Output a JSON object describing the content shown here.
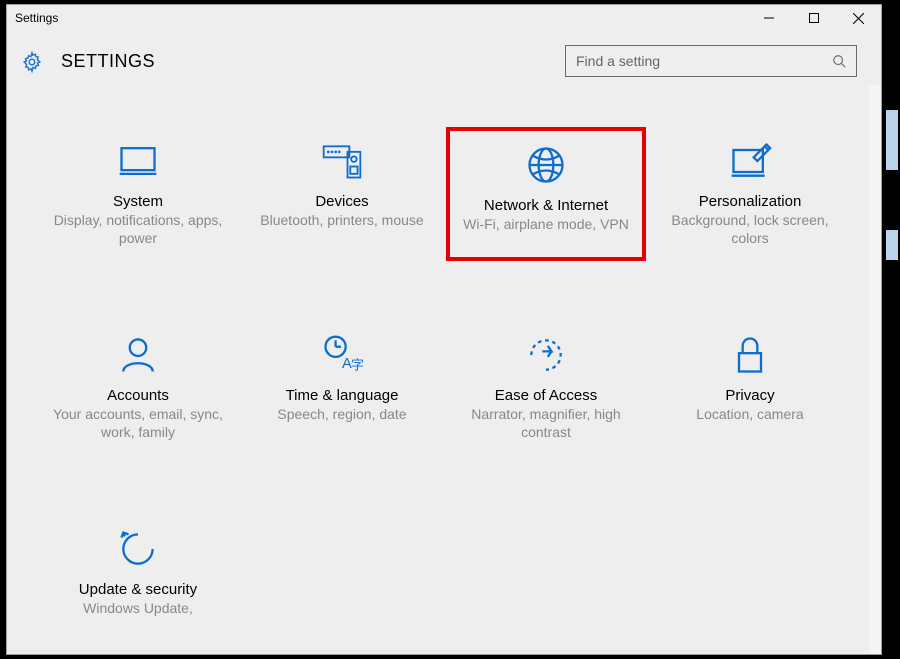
{
  "window": {
    "title": "Settings"
  },
  "header": {
    "title": "SETTINGS"
  },
  "search": {
    "placeholder": "Find a setting"
  },
  "tiles": [
    {
      "key": "system",
      "title": "System",
      "desc": "Display, notifications, apps, power",
      "highlighted": false
    },
    {
      "key": "devices",
      "title": "Devices",
      "desc": "Bluetooth, printers, mouse",
      "highlighted": false
    },
    {
      "key": "network",
      "title": "Network & Internet",
      "desc": "Wi-Fi, airplane mode, VPN",
      "highlighted": true
    },
    {
      "key": "personalization",
      "title": "Personalization",
      "desc": "Background, lock screen, colors",
      "highlighted": false
    },
    {
      "key": "accounts",
      "title": "Accounts",
      "desc": "Your accounts, email, sync, work, family",
      "highlighted": false
    },
    {
      "key": "time-language",
      "title": "Time & language",
      "desc": "Speech, region, date",
      "highlighted": false
    },
    {
      "key": "ease-of-access",
      "title": "Ease of Access",
      "desc": "Narrator, magnifier, high contrast",
      "highlighted": false
    },
    {
      "key": "privacy",
      "title": "Privacy",
      "desc": "Location, camera",
      "highlighted": false
    },
    {
      "key": "update-security",
      "title": "Update & security",
      "desc": "Windows Update,",
      "highlighted": false
    }
  ]
}
